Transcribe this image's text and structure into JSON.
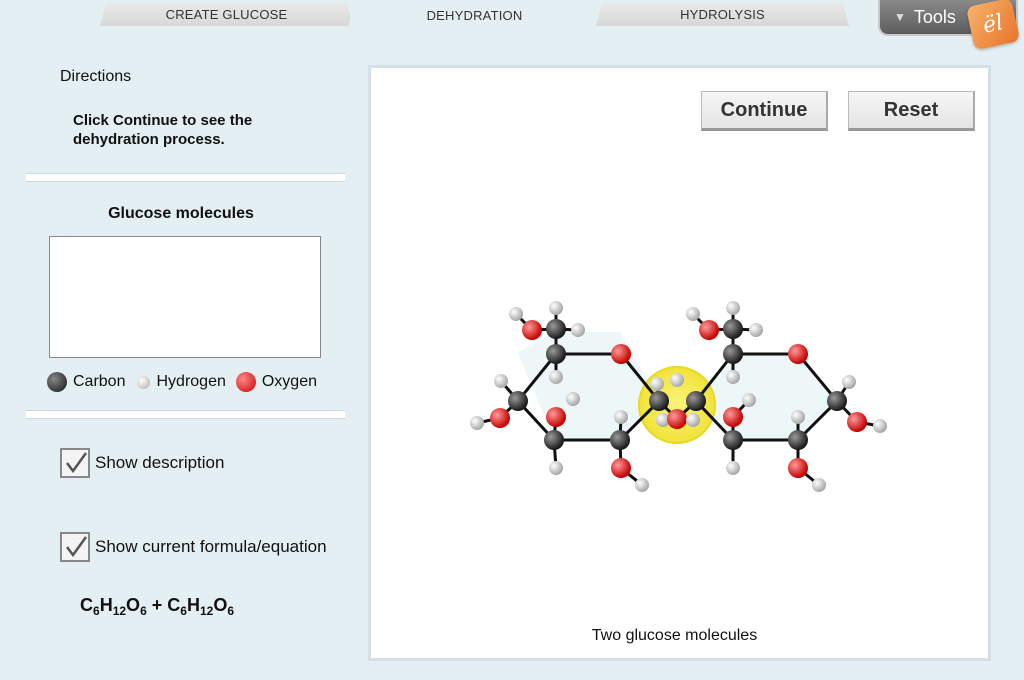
{
  "tabs": [
    {
      "label": "CREATE GLUCOSE",
      "active": false
    },
    {
      "label": "DEHYDRATION",
      "active": true
    },
    {
      "label": "HYDROLYSIS",
      "active": false
    }
  ],
  "tools": {
    "label": "Tools",
    "logo_text": "ël"
  },
  "directions": {
    "title": "Directions",
    "text": "Click Continue to see the dehydration process."
  },
  "glucose_panel": {
    "title": "Glucose molecules"
  },
  "legend": {
    "carbon": "Carbon",
    "hydrogen": "Hydrogen",
    "oxygen": "Oxygen"
  },
  "options": {
    "show_description": {
      "label": "Show description",
      "checked": true
    },
    "show_formula": {
      "label": "Show current formula/equation",
      "checked": true
    }
  },
  "formula": {
    "parts": [
      "C",
      "6",
      "H",
      "12",
      "O",
      "6",
      " + ",
      "C",
      "6",
      "H",
      "12",
      "O",
      "6"
    ]
  },
  "buttons": {
    "continue": "Continue",
    "reset": "Reset"
  },
  "caption": "Two glucose molecules",
  "colors": {
    "carbon": "#333333",
    "hydrogen": "#dddddd",
    "oxygen": "#dd2222",
    "highlight": "#f5e83a",
    "background": "#e3eff3"
  }
}
